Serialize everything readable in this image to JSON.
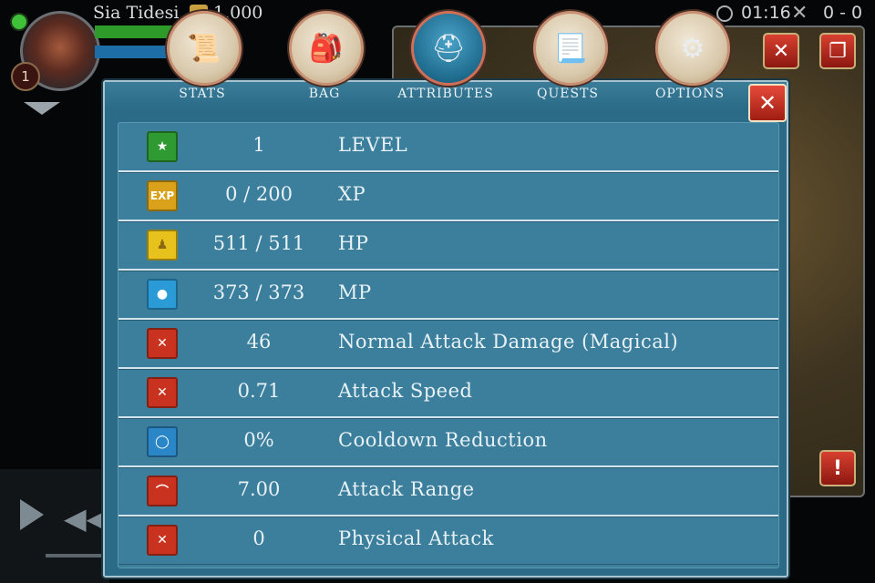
{
  "hud": {
    "player_name": "Sia Tidesi",
    "gold": "1,000",
    "portrait_level": "1",
    "match_time": "01:16",
    "score": "0 - 0"
  },
  "tabs": [
    {
      "label": "STATS",
      "icon": "scroll-icon",
      "active": false
    },
    {
      "label": "BAG",
      "icon": "bag-icon",
      "active": false
    },
    {
      "label": "ATTRIBUTES",
      "icon": "helmet-icon",
      "active": true
    },
    {
      "label": "QUESTS",
      "icon": "quest-scroll-icon",
      "active": false
    },
    {
      "label": "OPTIONS",
      "icon": "gears-icon",
      "active": false
    }
  ],
  "attributes": [
    {
      "value": "1",
      "label": "LEVEL",
      "icon": "level-star-icon",
      "color": "#2f9a32"
    },
    {
      "value": "0 / 200",
      "label": "XP",
      "icon": "exp-icon",
      "icon_text": "EXP",
      "color": "#d9a21a"
    },
    {
      "value": "511 / 511",
      "label": "HP",
      "icon": "body-icon",
      "color": "#e8c21c"
    },
    {
      "value": "373 / 373",
      "label": "MP",
      "icon": "head-mana-icon",
      "color": "#2a9bd6"
    },
    {
      "value": "46",
      "label": "Normal Attack Damage (Magical)",
      "icon": "magic-attack-icon",
      "color": "#c8321e"
    },
    {
      "value": "0.71",
      "label": "Attack Speed",
      "icon": "attack-speed-icon",
      "color": "#c8321e"
    },
    {
      "value": "0%",
      "label": "Cooldown Reduction",
      "icon": "cooldown-icon",
      "color": "#2a86c6"
    },
    {
      "value": "7.00",
      "label": "Attack Range",
      "icon": "attack-range-icon",
      "color": "#c8321e"
    },
    {
      "value": "0",
      "label": "Physical Attack",
      "icon": "physical-attack-icon",
      "color": "#c8321e"
    }
  ]
}
